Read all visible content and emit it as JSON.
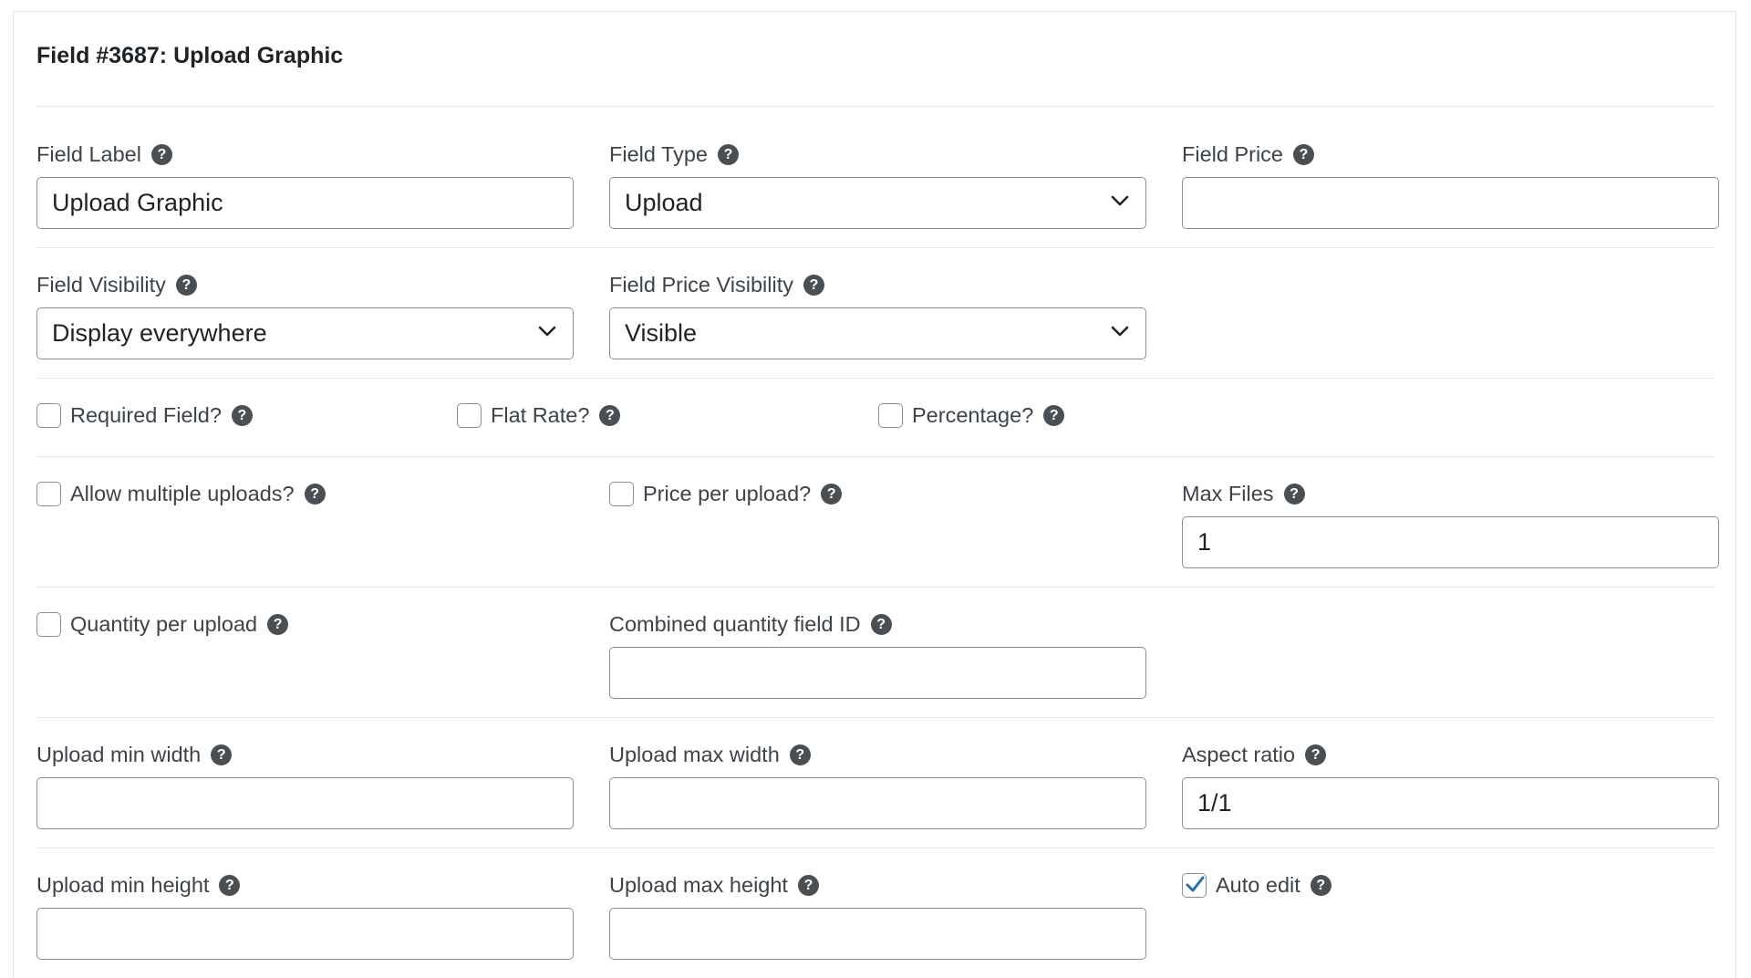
{
  "title": "Field #3687: Upload Graphic",
  "help_glyph": "?",
  "fields": {
    "field_label": {
      "label": "Field Label",
      "value": "Upload Graphic"
    },
    "field_type": {
      "label": "Field Type",
      "value": "Upload"
    },
    "field_price": {
      "label": "Field Price",
      "value": ""
    },
    "field_visibility": {
      "label": "Field Visibility",
      "value": "Display everywhere"
    },
    "field_price_visibility": {
      "label": "Field Price Visibility",
      "value": "Visible"
    },
    "max_files": {
      "label": "Max Files",
      "value": "1"
    },
    "combined_quantity_field_id": {
      "label": "Combined quantity field ID",
      "value": ""
    },
    "upload_min_width": {
      "label": "Upload min width",
      "value": ""
    },
    "upload_max_width": {
      "label": "Upload max width",
      "value": ""
    },
    "aspect_ratio": {
      "label": "Aspect ratio",
      "value": "1/1"
    },
    "upload_min_height": {
      "label": "Upload min height",
      "value": ""
    },
    "upload_max_height": {
      "label": "Upload max height",
      "value": ""
    }
  },
  "checkboxes": {
    "required_field": {
      "label": "Required Field?",
      "checked": false
    },
    "flat_rate": {
      "label": "Flat Rate?",
      "checked": false
    },
    "percentage": {
      "label": "Percentage?",
      "checked": false
    },
    "allow_multiple_uploads": {
      "label": "Allow multiple uploads?",
      "checked": false
    },
    "price_per_upload": {
      "label": "Price per upload?",
      "checked": false
    },
    "quantity_per_upload": {
      "label": "Quantity per upload",
      "checked": false
    },
    "auto_edit": {
      "label": "Auto edit",
      "checked": true
    }
  },
  "colors": {
    "check_accent": "#2271b1",
    "help_icon": "#4a4f54",
    "input_border": "#8c8f94"
  }
}
